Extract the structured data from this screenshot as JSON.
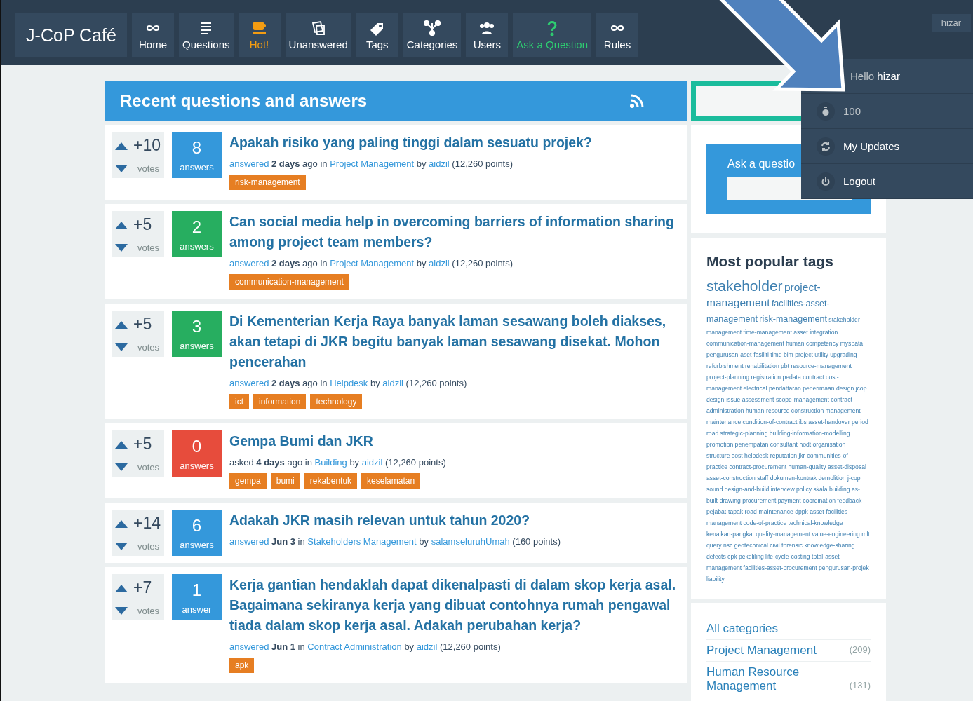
{
  "header": {
    "logo": "J-CoP Café",
    "nav": [
      {
        "label": "Home",
        "color": "#ffffff"
      },
      {
        "label": "Questions",
        "color": "#ffffff"
      },
      {
        "label": "Hot!",
        "color": "#f39c12"
      },
      {
        "label": "Unanswered",
        "color": "#ffffff"
      },
      {
        "label": "Tags",
        "color": "#ffffff"
      },
      {
        "label": "Categories",
        "color": "#ffffff"
      },
      {
        "label": "Users",
        "color": "#ffffff"
      },
      {
        "label": "Ask a Question",
        "color": "#2ecc71"
      },
      {
        "label": "Rules",
        "color": "#ffffff"
      }
    ],
    "user_button": "hizar"
  },
  "user_menu": {
    "greeting": "Hello",
    "username": "hizar",
    "items": [
      {
        "label": "100",
        "kind": "points"
      },
      {
        "label": "My Updates",
        "kind": "updates"
      },
      {
        "label": "Logout",
        "kind": "logout"
      }
    ]
  },
  "main": {
    "title": "Recent questions and answers",
    "questions": [
      {
        "votes": "+10",
        "votes_label": "votes",
        "answers": "8",
        "answers_label": "answers",
        "color": "#3498db",
        "title": "Apakah risiko yang paling tinggi dalam sesuatu projek?",
        "meta": [
          {
            "text": "answered",
            "kind": "link"
          },
          {
            "text": "2 days",
            "kind": "bold"
          },
          {
            "text": "ago in",
            "kind": "plain"
          },
          {
            "text": "Project Management",
            "kind": "link"
          },
          {
            "text": "by",
            "kind": "plain"
          },
          {
            "text": "aidzil",
            "kind": "link"
          },
          {
            "text": "(12,260 points)",
            "kind": "plain"
          }
        ],
        "tags": [
          "risk-management"
        ]
      },
      {
        "votes": "+5",
        "votes_label": "votes",
        "answers": "2",
        "answers_label": "answers",
        "color": "#27ae60",
        "title": "Can social media help in overcoming barriers of information sharing among project team members?",
        "meta": [
          {
            "text": "answered",
            "kind": "link"
          },
          {
            "text": "2 days",
            "kind": "bold"
          },
          {
            "text": "ago in",
            "kind": "plain"
          },
          {
            "text": "Project Management",
            "kind": "link"
          },
          {
            "text": "by",
            "kind": "plain"
          },
          {
            "text": "aidzil",
            "kind": "link"
          },
          {
            "text": "(12,260 points)",
            "kind": "plain"
          }
        ],
        "tags": [
          "communication-management"
        ]
      },
      {
        "votes": "+5",
        "votes_label": "votes",
        "answers": "3",
        "answers_label": "answers",
        "color": "#27ae60",
        "title": "Di Kementerian Kerja Raya banyak laman sesawang boleh diakses, akan tetapi di JKR begitu banyak laman sesawang disekat. Mohon pencerahan",
        "meta": [
          {
            "text": "answered",
            "kind": "link"
          },
          {
            "text": "2 days",
            "kind": "bold"
          },
          {
            "text": "ago in",
            "kind": "plain"
          },
          {
            "text": "Helpdesk",
            "kind": "link"
          },
          {
            "text": "by",
            "kind": "plain"
          },
          {
            "text": "aidzil",
            "kind": "link"
          },
          {
            "text": "(12,260 points)",
            "kind": "plain"
          }
        ],
        "tags": [
          "ict",
          "information",
          "technology"
        ]
      },
      {
        "votes": "+5",
        "votes_label": "votes",
        "answers": "0",
        "answers_label": "answers",
        "color": "#e74c3c",
        "title": "Gempa Bumi dan JKR",
        "meta": [
          {
            "text": "asked",
            "kind": "plain"
          },
          {
            "text": "4 days",
            "kind": "bold"
          },
          {
            "text": "ago in",
            "kind": "plain"
          },
          {
            "text": "Building",
            "kind": "link"
          },
          {
            "text": "by",
            "kind": "plain"
          },
          {
            "text": "aidzil",
            "kind": "link"
          },
          {
            "text": "(12,260 points)",
            "kind": "plain"
          }
        ],
        "tags": [
          "gempa",
          "bumi",
          "rekabentuk",
          "keselamatan"
        ]
      },
      {
        "votes": "+14",
        "votes_label": "votes",
        "answers": "6",
        "answers_label": "answers",
        "color": "#3498db",
        "title": "Adakah JKR masih relevan untuk tahun 2020?",
        "meta": [
          {
            "text": "answered",
            "kind": "link"
          },
          {
            "text": "Jun 3",
            "kind": "bold"
          },
          {
            "text": "in",
            "kind": "plain"
          },
          {
            "text": "Stakeholders Management",
            "kind": "link"
          },
          {
            "text": "by",
            "kind": "plain"
          },
          {
            "text": "salamseluruhUmah",
            "kind": "link"
          },
          {
            "text": "(160 points)",
            "kind": "plain"
          }
        ]
      },
      {
        "votes": "+7",
        "votes_label": "votes",
        "answers": "1",
        "answers_label": "answer",
        "color": "#3498db",
        "title": "Kerja gantian hendaklah dapat dikenalpasti di dalam skop kerja asal. Bagaimana sekiranya kerja yang dibuat contohnya rumah pengawal tiada dalam skop kerja asal. Adakah perubahan kerja?",
        "meta": [
          {
            "text": "answered",
            "kind": "link"
          },
          {
            "text": "Jun 1",
            "kind": "bold"
          },
          {
            "text": "in",
            "kind": "plain"
          },
          {
            "text": "Contract Administration",
            "kind": "link"
          },
          {
            "text": "by",
            "kind": "plain"
          },
          {
            "text": "aidzil",
            "kind": "link"
          },
          {
            "text": "(12,260 points)",
            "kind": "plain"
          }
        ],
        "tags": [
          "apk"
        ]
      }
    ]
  },
  "sidebar": {
    "ask_label": "Ask a questio",
    "popular_tags": {
      "title": "Most popular tags",
      "groups": [
        {
          "tags": [
            "stakeholder"
          ]
        },
        {
          "tags": [
            "project-management"
          ]
        },
        {
          "tags": [
            "facilities-asset-management",
            "risk-management"
          ]
        },
        {
          "tags": [
            "stakeholder-management",
            "time-management",
            "asset",
            "integration",
            "communication-management",
            "human",
            "competency",
            "myspata",
            "pengurusan-aset-fasiliti",
            "time",
            "bim",
            "project",
            "utility",
            "upgrading",
            "refurbishment",
            "rehabilitation",
            "pbt",
            "resource-management",
            "project-planning",
            "registration",
            "pedata",
            "contract",
            "cost-management",
            "electrical",
            "pendaftaran",
            "penerimaan",
            "design",
            "jcop",
            "design-issue",
            "assessment",
            "scope-management",
            "contract-administration",
            "human-resource",
            "construction",
            "management",
            "maintenance",
            "condition-of-contract",
            "ibs",
            "asset-handover",
            "period",
            "road",
            "strategic-planning",
            "building-information-modelling",
            "promotion",
            "penempatan",
            "consultant",
            "hodt",
            "organisation",
            "structure",
            "cost",
            "helpdesk",
            "reputation",
            "jkr-communities-of-practice",
            "contract-procurement",
            "human-quality",
            "asset-disposal",
            "asset-construction",
            "staff",
            "dokumen-kontrak",
            "demolition",
            "j-cop",
            "sound",
            "design-and-build",
            "interview",
            "policy",
            "skala",
            "building",
            "as-built-drawing",
            "procurement",
            "payment",
            "coordination",
            "feedback",
            "pejabat-tapak",
            "road-maintenance",
            "dppk",
            "asset-facilities-management",
            "code-of-practice",
            "technical-knowledge",
            "kenaikan-pangkat",
            "quality-management",
            "value-engineering",
            "mlt",
            "query",
            "nsc",
            "geotechnical",
            "civil",
            "forensic",
            "knowledge-sharing",
            "defects",
            "cpk",
            "pekeliling",
            "life-cycle-costing",
            "total-asset-management",
            "facilities-asset-procurement",
            "pengurusan-projek",
            "liability"
          ]
        }
      ]
    },
    "categories": [
      {
        "label": "All categories"
      },
      {
        "label": "Project Management",
        "count": "(209)"
      },
      {
        "label": "Human Resource Management",
        "count": "(131)"
      }
    ]
  }
}
